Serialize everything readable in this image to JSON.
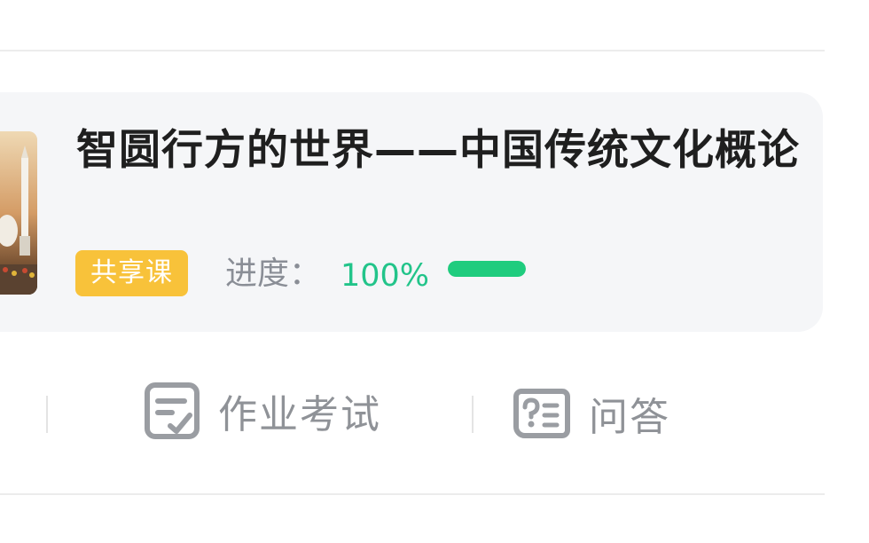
{
  "course": {
    "title": "智圆行方的世界——中国传统文化概论",
    "tag": "共享课",
    "progress_label": "进度：",
    "progress_value": "100%",
    "progress_fraction": 1.0
  },
  "actions": [
    {
      "label": "作业考试",
      "icon": "homework-exam-icon"
    },
    {
      "label": "问答",
      "icon": "qa-icon"
    }
  ],
  "colors": {
    "card_background": "#f5f6f8",
    "tag_background": "#f8c23a",
    "progress_green": "#1fcc7e",
    "progress_text": "#22c48a",
    "title_text": "#1f1f1f",
    "muted_text": "#8f9297"
  }
}
